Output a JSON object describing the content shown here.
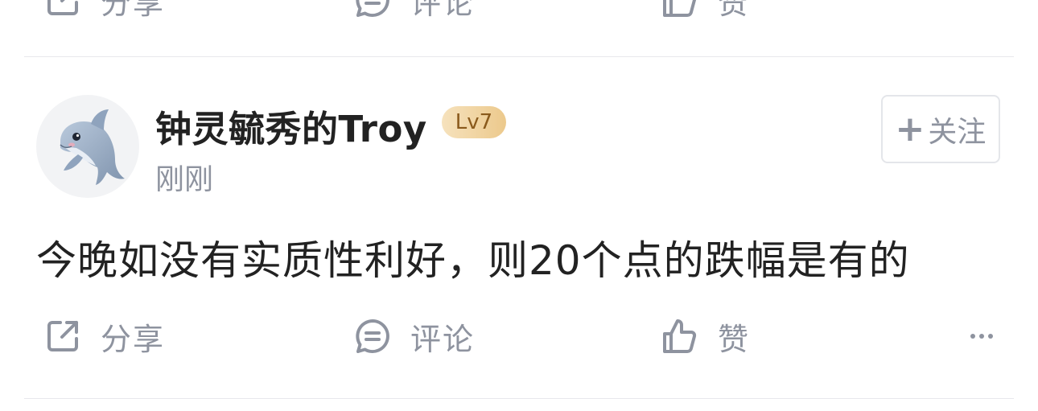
{
  "previous_post": {
    "actions": {
      "share_label": "分享",
      "comment_label": "评论",
      "like_label": "赞"
    }
  },
  "post": {
    "author": {
      "name": "钟灵毓秀的Troy",
      "level": "Lv7",
      "avatar_icon": "dolphin-avatar"
    },
    "time": "刚刚",
    "follow": {
      "label": "关注",
      "plus": "+"
    },
    "content": "今晚如没有实质性利好，则20个点的跌幅是有的",
    "actions": {
      "share_label": "分享",
      "comment_label": "评论",
      "like_label": "赞",
      "more_icon": "more-icon"
    }
  },
  "colors": {
    "text_primary": "#222222",
    "text_secondary": "#8e939f",
    "divider": "#e8e8ec",
    "level_badge": "#ecc98c"
  }
}
